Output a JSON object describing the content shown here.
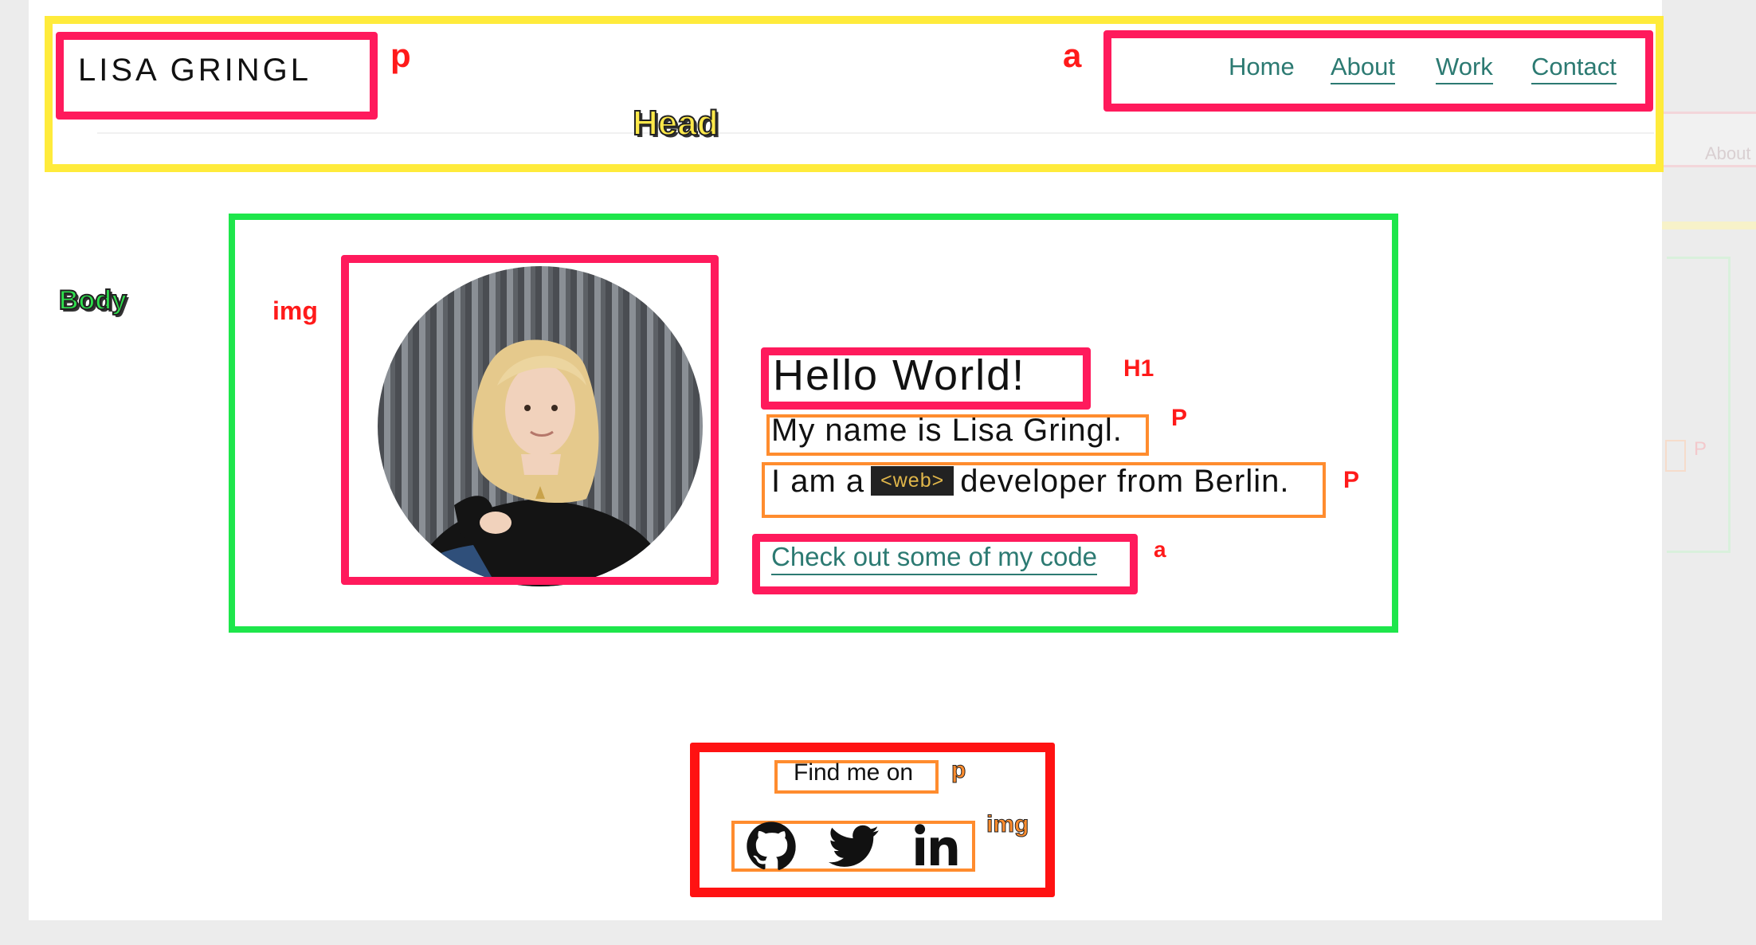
{
  "header": {
    "logo_text": "LISA GRINGL",
    "nav": [
      "Home",
      "About",
      "Work",
      "Contact"
    ]
  },
  "hero": {
    "heading": "Hello World!",
    "intro": "My name is Lisa Gringl.",
    "role_prefix": "I am a",
    "role_chip": "<web>",
    "role_suffix": "developer from Berlin.",
    "code_link": "Check out some of my code"
  },
  "footer": {
    "find_label": "Find me on",
    "social_icons": [
      "github-icon",
      "twitter-icon",
      "linkedin-icon"
    ]
  },
  "annotations": {
    "head": "Head",
    "body": "Body",
    "p": "p",
    "a": "a",
    "img": "img",
    "h1": "H1",
    "P": "P"
  },
  "colors": {
    "head_frame": "#ffeb3b",
    "body_frame": "#1ee64b",
    "element_frame": "#ff1a5c",
    "text_frame": "#ff8c2e",
    "footer_frame": "#ff1212",
    "link": "#2c7a72"
  },
  "ghost": {
    "about": "About",
    "p": "P"
  }
}
